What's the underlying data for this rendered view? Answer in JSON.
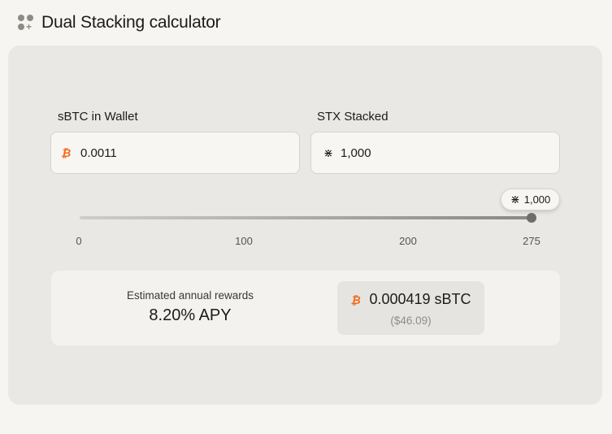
{
  "header": {
    "title": "Dual Stacking calculator",
    "icon": "apps-add-icon"
  },
  "inputs": {
    "sbtc": {
      "label": "sBTC in Wallet",
      "value": "0.0011",
      "icon": "sbtc-icon"
    },
    "stx": {
      "label": "STX Stacked",
      "value": "1,000",
      "icon": "stx-icon"
    }
  },
  "slider": {
    "tooltip": "1,000",
    "ticks": [
      "0",
      "100",
      "200",
      "275"
    ],
    "fill_fraction": 1.0
  },
  "rewards": {
    "label": "Estimated annual rewards",
    "apy": "8.20% APY",
    "amount": "0.000419 sBTC",
    "usd": "($46.09)"
  },
  "colors": {
    "accent_orange": "#f36b1c",
    "card_bg": "#e9e8e5",
    "page_bg": "#f6f5f2"
  }
}
